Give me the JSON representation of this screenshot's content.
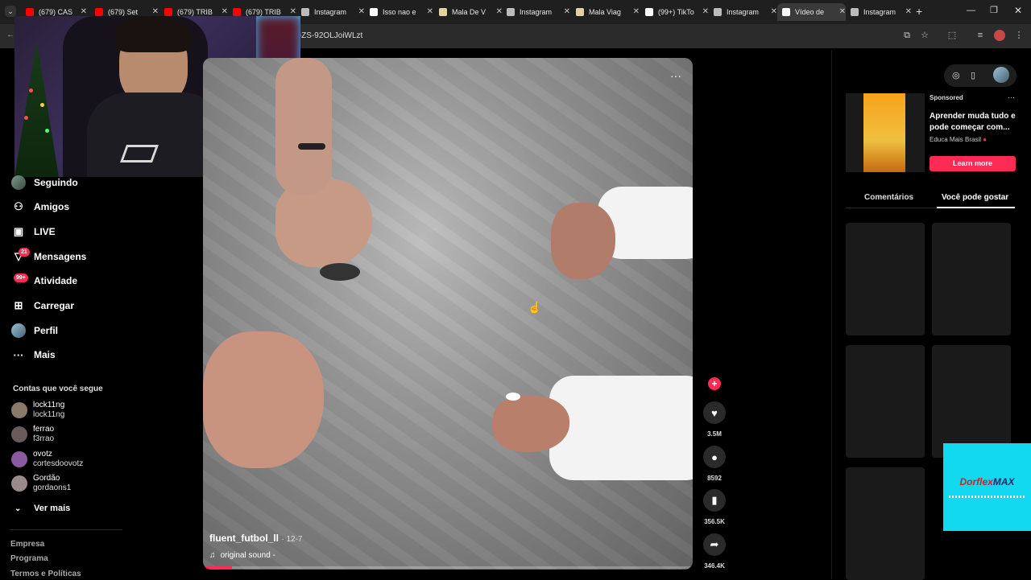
{
  "browser": {
    "tabs": [
      {
        "label": "(679) CAS",
        "fav": "#ff0000"
      },
      {
        "label": "(679) Set",
        "fav": "#ff0000"
      },
      {
        "label": "(679) TRIB",
        "fav": "#ff0000"
      },
      {
        "label": "(679) TRIB",
        "fav": "#ff0000"
      },
      {
        "label": "Instagram",
        "fav": "#bbbbbb"
      },
      {
        "label": "Isso nao e",
        "fav": "#ffffff"
      },
      {
        "label": "Mala De V",
        "fav": "#e0d3a0"
      },
      {
        "label": "Instagram",
        "fav": "#bbbbbb"
      },
      {
        "label": "Mala Viag",
        "fav": "#e0d3a0"
      },
      {
        "label": "(99+) TikTo",
        "fav": "#ffffff"
      },
      {
        "label": "Instagram",
        "fav": "#bbbbbb"
      },
      {
        "label": "Vídeo de",
        "fav": "#ffffff"
      },
      {
        "label": "Instagram",
        "fav": "#bbbbbb"
      }
    ],
    "new_tab": "+",
    "url_fragment": "_t=ZS-92OLJoiWLzt"
  },
  "sidebar": {
    "nav": [
      {
        "label": "Seguindo",
        "icon": "avatar-icon"
      },
      {
        "label": "Amigos",
        "icon": "friends-icon"
      },
      {
        "label": "LIVE",
        "icon": "live-icon"
      },
      {
        "label": "Mensagens",
        "icon": "messages-icon"
      },
      {
        "label": "Atividade",
        "icon": "activity-icon"
      },
      {
        "label": "Carregar",
        "icon": "upload-icon"
      },
      {
        "label": "Perfil",
        "icon": "profile-icon"
      },
      {
        "label": "Mais",
        "icon": "more-icon"
      }
    ],
    "messages_badge": "21",
    "activity_badge": "99+",
    "following_title": "Contas que você segue",
    "accounts": [
      {
        "name": "lock11ng",
        "handle": "lock11ng",
        "color": "#8a7a6a"
      },
      {
        "name": "ferrao",
        "handle": "f3rrao",
        "color": "#6a5a5a"
      },
      {
        "name": "ovotz",
        "handle": "cortesdoovotz",
        "color": "#8a5aa0"
      },
      {
        "name": "Gordão",
        "handle": "gordaons1",
        "color": "#9a8a8a"
      }
    ],
    "see_more": "Ver mais",
    "footer": [
      "Empresa",
      "Programa",
      "Termos e Políticas"
    ]
  },
  "video": {
    "author": "fluent_futbol_ll",
    "date": "· 12-7",
    "sound": "original sound -",
    "progress": 0.06
  },
  "actions": {
    "likes": "3.5M",
    "comments": "8592",
    "saves": "356.5K",
    "shares": "346.4K"
  },
  "ad": {
    "sponsored": "Sponsored",
    "title": "Aprender muda tudo e pode começar com...",
    "advertiser": "Educa Mais Brasil",
    "cta": "Learn more",
    "more": "···"
  },
  "panel_tabs": {
    "comments": "Comentários",
    "you_may_like": "Você pode gostar"
  },
  "overlay_ad": {
    "brand_a": "Dorflex",
    "brand_b": "MAX"
  },
  "colors": {
    "accent": "#fe2c55",
    "overlay_bg": "#12d9f0"
  }
}
